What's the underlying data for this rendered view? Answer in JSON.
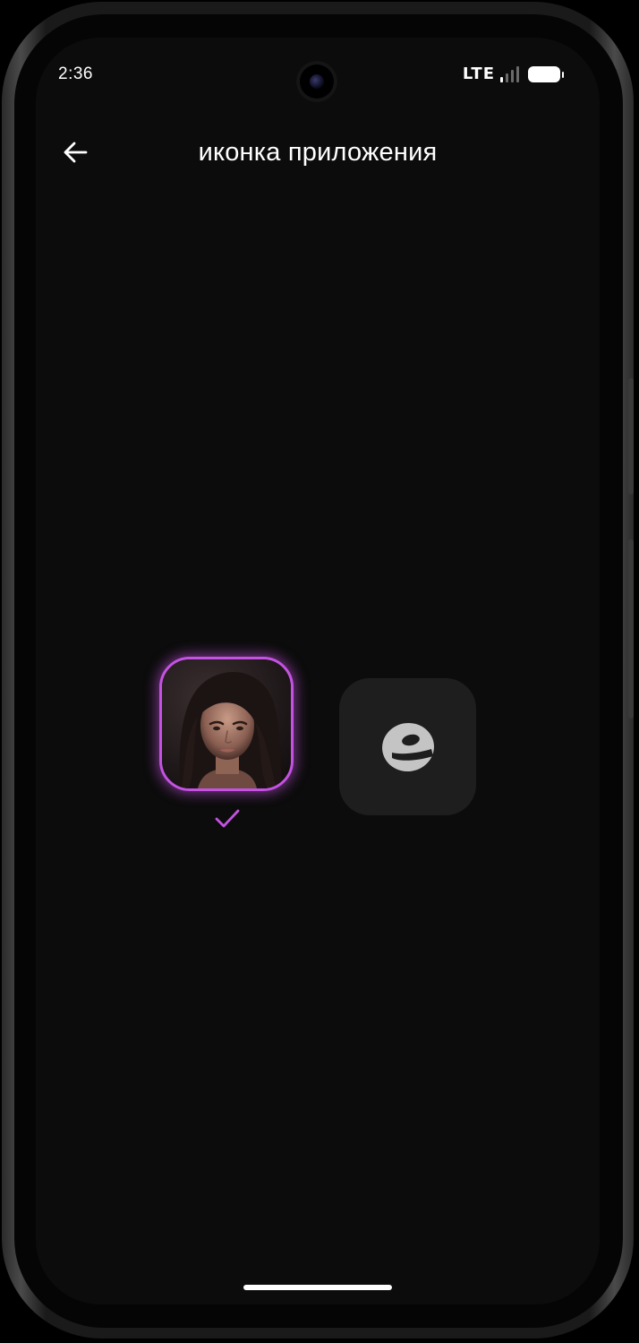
{
  "status_bar": {
    "time": "2:36",
    "network": "LTE",
    "signal_bars_active": 1,
    "signal_bars_total": 4
  },
  "header": {
    "title": "иконка приложения",
    "back_icon": "arrow-left-icon"
  },
  "icon_options": [
    {
      "id": "portrait",
      "icon": "woman-portrait-image",
      "selected": true
    },
    {
      "id": "brand",
      "icon": "letter-e-logo-icon",
      "selected": false
    }
  ],
  "selection_indicator": {
    "icon": "check-icon",
    "color": "#c552e2"
  },
  "colors": {
    "background": "#0c0c0c",
    "accent": "#c552e2",
    "text": "#ffffff",
    "tile": "#1e1e1e"
  }
}
